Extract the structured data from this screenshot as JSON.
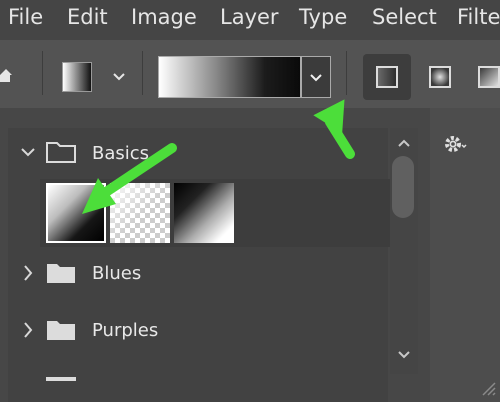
{
  "menu": {
    "items": [
      "File",
      "Edit",
      "Image",
      "Layer",
      "Type",
      "Select",
      "Filter"
    ]
  },
  "options_bar": {
    "dropdown_icon": "chevron-down-icon",
    "gradient_type_buttons": [
      "linear-gradient-icon",
      "radial-gradient-icon",
      "angle-gradient-icon"
    ]
  },
  "gradient_picker": {
    "groups": [
      {
        "name": "Basics",
        "expanded": true,
        "presets": [
          "Foreground to Background",
          "Foreground to Transparent",
          "Black, White"
        ]
      },
      {
        "name": "Blues",
        "expanded": false
      },
      {
        "name": "Purples",
        "expanded": false
      }
    ],
    "settings_icon": "gear-icon"
  },
  "colors": {
    "annotation_arrow": "#4cde3a",
    "menubar_bg": "#454545",
    "panel_bg": "#474747"
  }
}
